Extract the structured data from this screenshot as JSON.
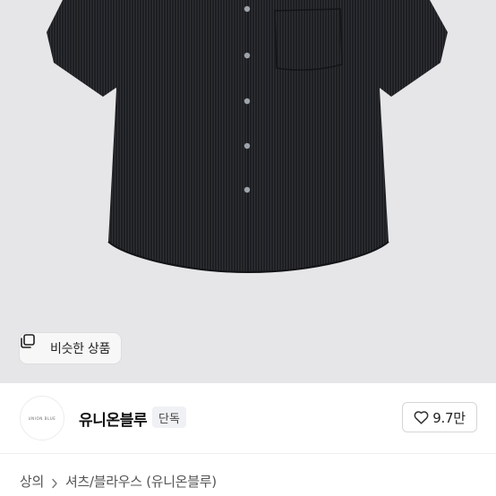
{
  "product_image": {
    "alt": ""
  },
  "similar_button": {
    "label": "비슷한 상품",
    "icon": "similar-items-icon"
  },
  "seller": {
    "logo_text": "UNION BLUE",
    "name": "유니온블루",
    "badge": "단독"
  },
  "like": {
    "count": "9.7만",
    "icon": "heart-icon"
  },
  "breadcrumb": {
    "level1": "상의",
    "level2": "셔츠/블라우스 (유니온블루)"
  },
  "colors": {
    "photo_bg": "#e6e6e8",
    "shirt": "#1e1f22"
  }
}
